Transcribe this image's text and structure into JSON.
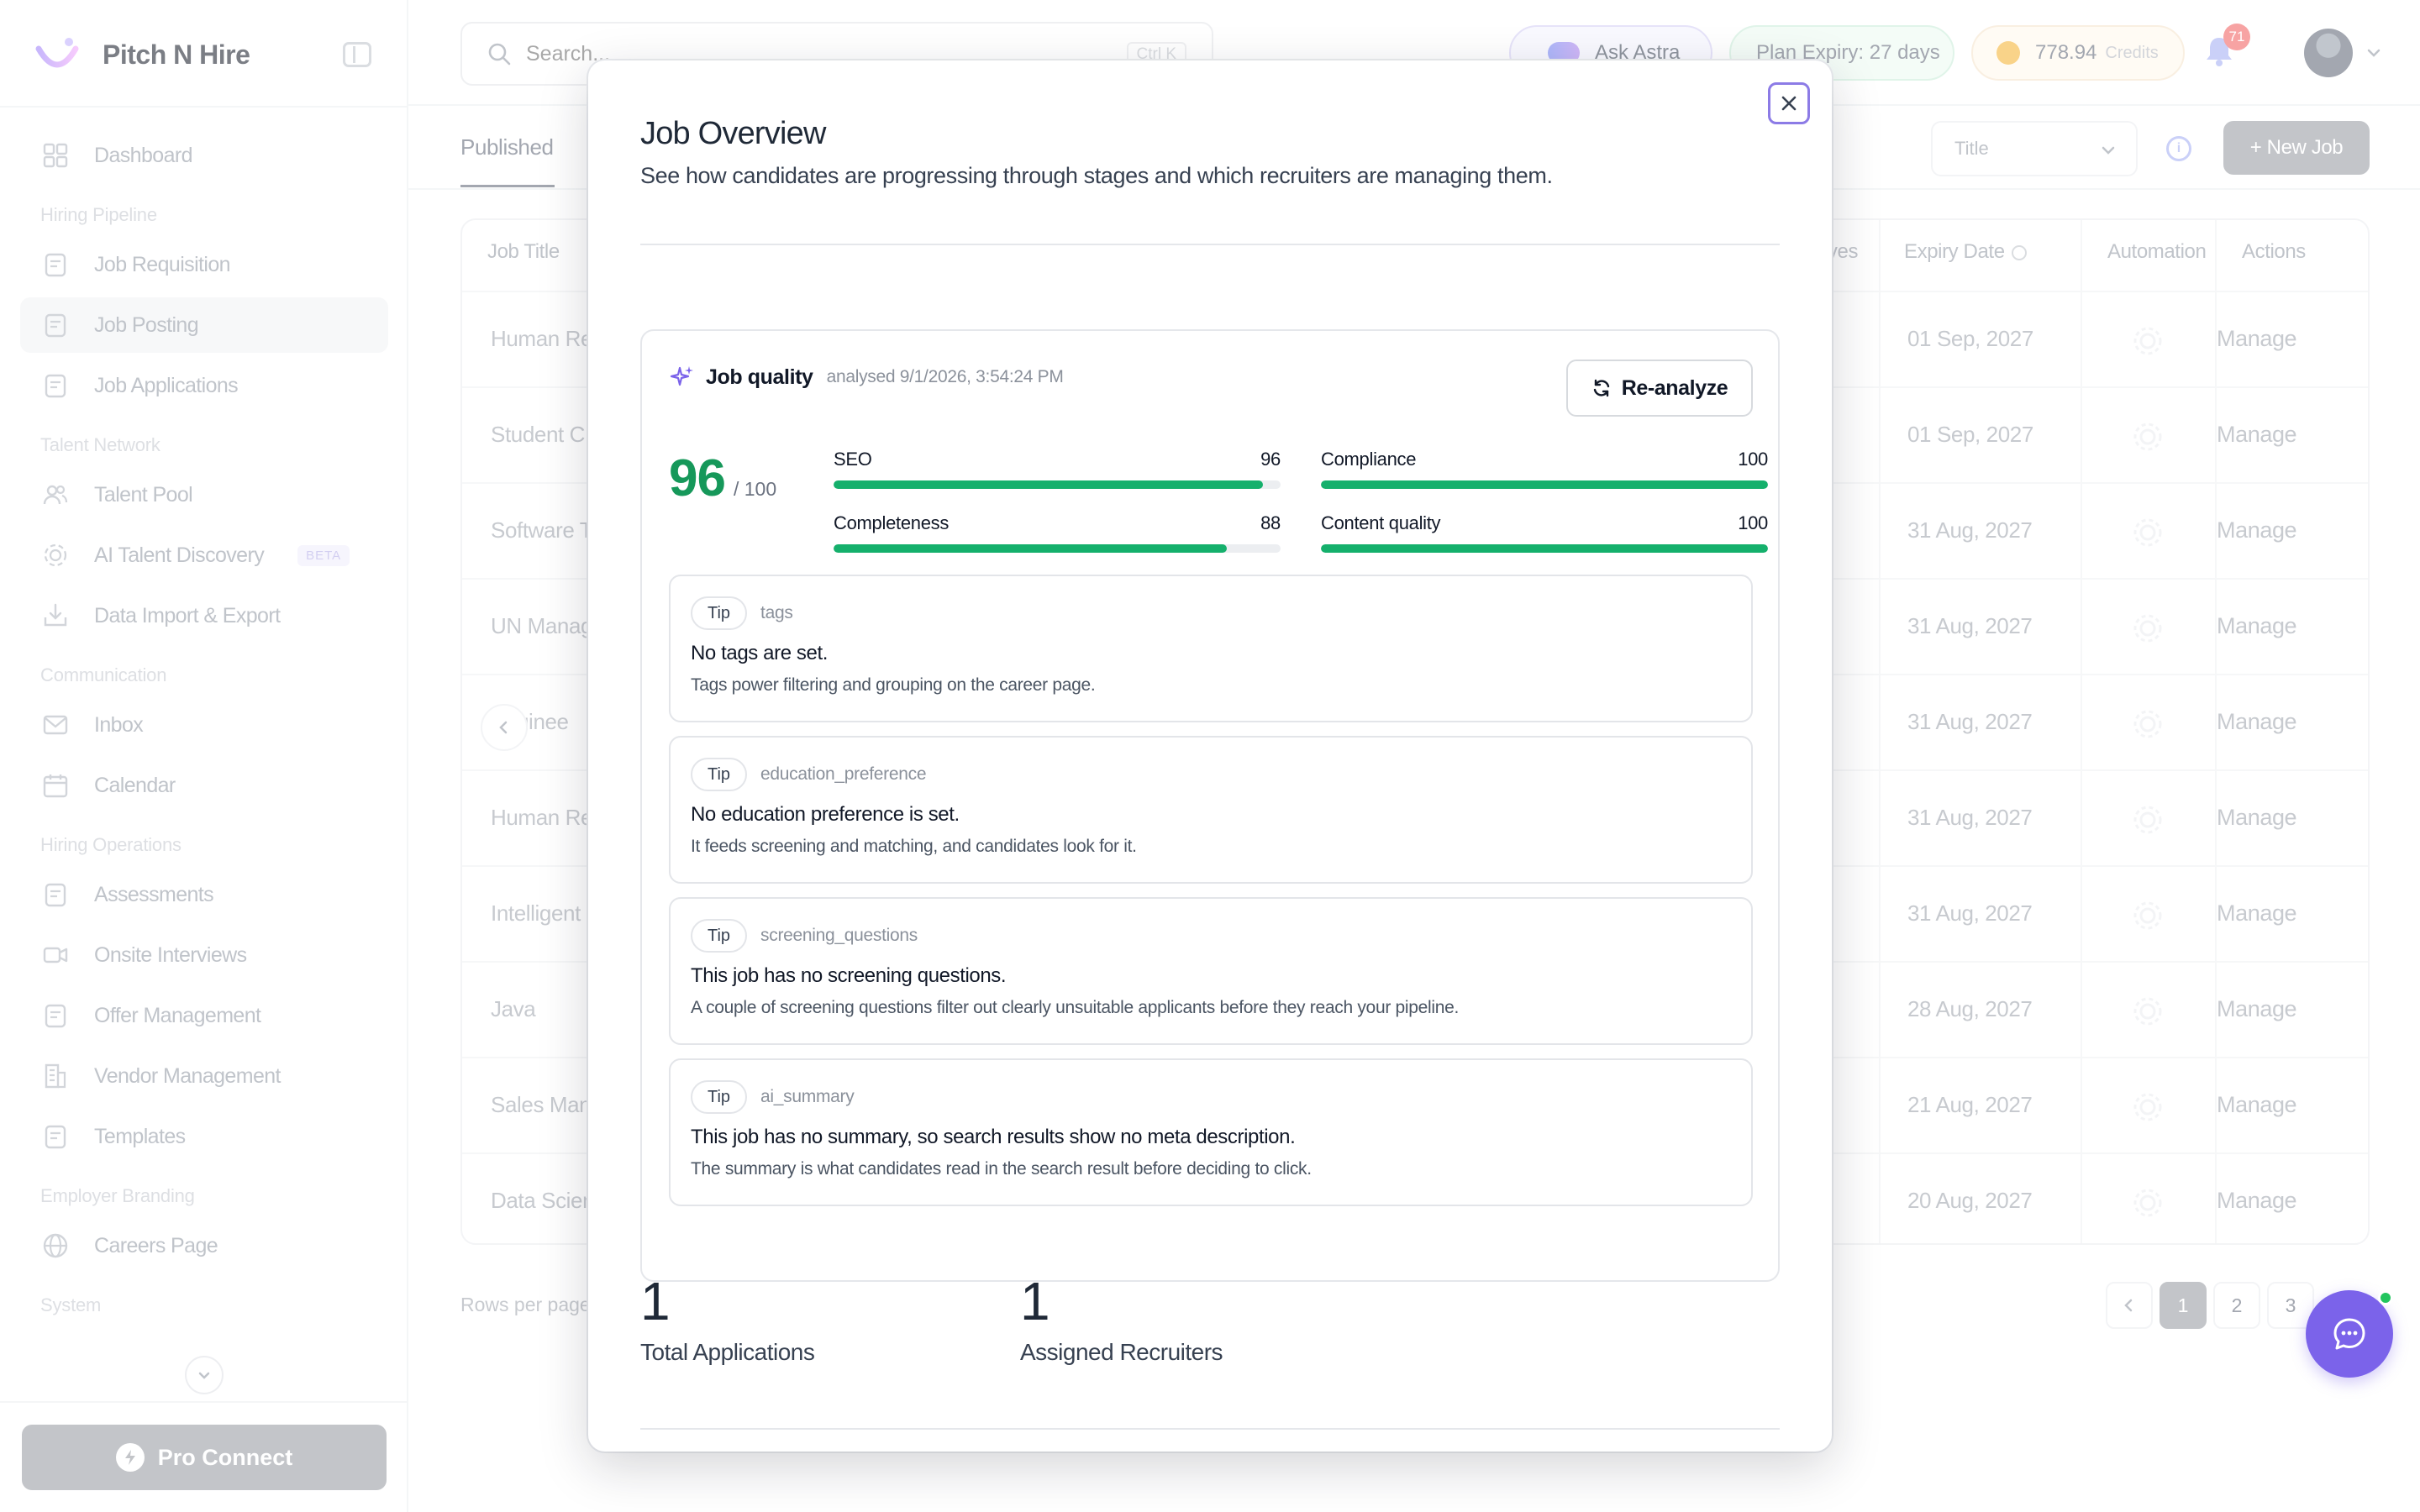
{
  "brand": {
    "name": "Pitch N Hire"
  },
  "sidebar": {
    "items": [
      {
        "type": "item",
        "label": "Dashboard",
        "icon": "grid-icon"
      },
      {
        "type": "section",
        "label": "Hiring Pipeline"
      },
      {
        "type": "item",
        "label": "Job Requisition",
        "icon": "requisition-icon"
      },
      {
        "type": "item",
        "label": "Job Posting",
        "icon": "briefcase-icon",
        "active": true
      },
      {
        "type": "item",
        "label": "Job Applications",
        "icon": "applications-icon"
      },
      {
        "type": "section",
        "label": "Talent Network"
      },
      {
        "type": "item",
        "label": "Talent Pool",
        "icon": "users-icon"
      },
      {
        "type": "item",
        "label": "AI Talent Discovery",
        "icon": "ai-spiral-icon",
        "badge": "BETA"
      },
      {
        "type": "item",
        "label": "Data Import & Export",
        "icon": "import-icon"
      },
      {
        "type": "section",
        "label": "Communication"
      },
      {
        "type": "item",
        "label": "Inbox",
        "icon": "mail-icon"
      },
      {
        "type": "item",
        "label": "Calendar",
        "icon": "calendar-icon"
      },
      {
        "type": "section",
        "label": "Hiring Operations"
      },
      {
        "type": "item",
        "label": "Assessments",
        "icon": "clipboard-icon"
      },
      {
        "type": "item",
        "label": "Onsite Interviews",
        "icon": "video-icon"
      },
      {
        "type": "item",
        "label": "Offer Management",
        "icon": "offer-icon"
      },
      {
        "type": "item",
        "label": "Vendor Management",
        "icon": "building-icon"
      },
      {
        "type": "item",
        "label": "Templates",
        "icon": "template-icon"
      },
      {
        "type": "section",
        "label": "Employer Branding"
      },
      {
        "type": "item",
        "label": "Careers Page",
        "icon": "globe-icon"
      },
      {
        "type": "section",
        "label": "System"
      }
    ],
    "pro_connect_label": "Pro Connect"
  },
  "topbar": {
    "search_placeholder": "Search...",
    "search_shortcut": "Ctrl K",
    "ask_astra": "Ask Astra",
    "plan_expiry": "Plan Expiry: 27 days",
    "credits_value": "778.94",
    "credits_unit": "Credits",
    "notification_count": "71"
  },
  "jobs_page": {
    "tab_published": "Published",
    "filter_selected": "Title",
    "new_job_label": "+ New Job",
    "columns": {
      "job_title": "Job Title",
      "actives": "ives",
      "expiry_date": "Expiry Date",
      "automation": "Automation",
      "actions": "Actions"
    },
    "rows": [
      {
        "title": "Human Re",
        "expiry": "01 Sep, 2027",
        "action": "Manage"
      },
      {
        "title": "Student C",
        "expiry": "01 Sep, 2027",
        "action": "Manage"
      },
      {
        "title": "Software T",
        "expiry": "31 Aug, 2027",
        "action": "Manage"
      },
      {
        "title": "UN Manag",
        "expiry": "31 Aug, 2027",
        "action": "Manage"
      },
      {
        "title": "Enginee",
        "expiry": "31 Aug, 2027",
        "action": "Manage"
      },
      {
        "title": "Human Re",
        "expiry": "31 Aug, 2027",
        "action": "Manage"
      },
      {
        "title": "Intelligent",
        "expiry": "31 Aug, 2027",
        "action": "Manage"
      },
      {
        "title": "Java",
        "expiry": "28 Aug, 2027",
        "action": "Manage"
      },
      {
        "title": "Sales Man",
        "expiry": "21 Aug, 2027",
        "action": "Manage"
      },
      {
        "title": "Data Scien",
        "expiry": "20 Aug, 2027",
        "action": "Manage"
      }
    ],
    "rows_per_page_label": "Rows per page",
    "pages": [
      "1",
      "2",
      "3"
    ],
    "current_page": "1"
  },
  "modal": {
    "title": "Job Overview",
    "subtitle": "See how candidates are progressing through stages and which recruiters are managing them.",
    "quality": {
      "title": "Job quality",
      "analysed": "analysed 9/1/2026, 3:54:24 PM",
      "reanalyze_label": "Re-analyze",
      "score": "96",
      "score_max": "/ 100",
      "metrics": [
        {
          "label": "SEO",
          "value": 96
        },
        {
          "label": "Compliance",
          "value": 100
        },
        {
          "label": "Completeness",
          "value": 88
        },
        {
          "label": "Content quality",
          "value": 100
        }
      ],
      "tips": [
        {
          "badge": "Tip",
          "key": "tags",
          "message": "No tags are set.",
          "detail": "Tags power filtering and grouping on the career page."
        },
        {
          "badge": "Tip",
          "key": "education_preference",
          "message": "No education preference is set.",
          "detail": "It feeds screening and matching, and candidates look for it."
        },
        {
          "badge": "Tip",
          "key": "screening_questions",
          "message": "This job has no screening questions.",
          "detail": "A couple of screening questions filter out clearly unsuitable applicants before they reach your pipeline."
        },
        {
          "badge": "Tip",
          "key": "ai_summary",
          "message": "This job has no summary, so search results show no meta description.",
          "detail": "The summary is what candidates read in the search result before deciding to click."
        }
      ]
    },
    "stats": [
      {
        "value": "1",
        "label": "Total Applications"
      },
      {
        "value": "1",
        "label": "Assigned Recruiters"
      }
    ]
  },
  "colors": {
    "accent": "#7b63ea",
    "score_green": "#16985a",
    "bar_green": "#15b06c"
  }
}
